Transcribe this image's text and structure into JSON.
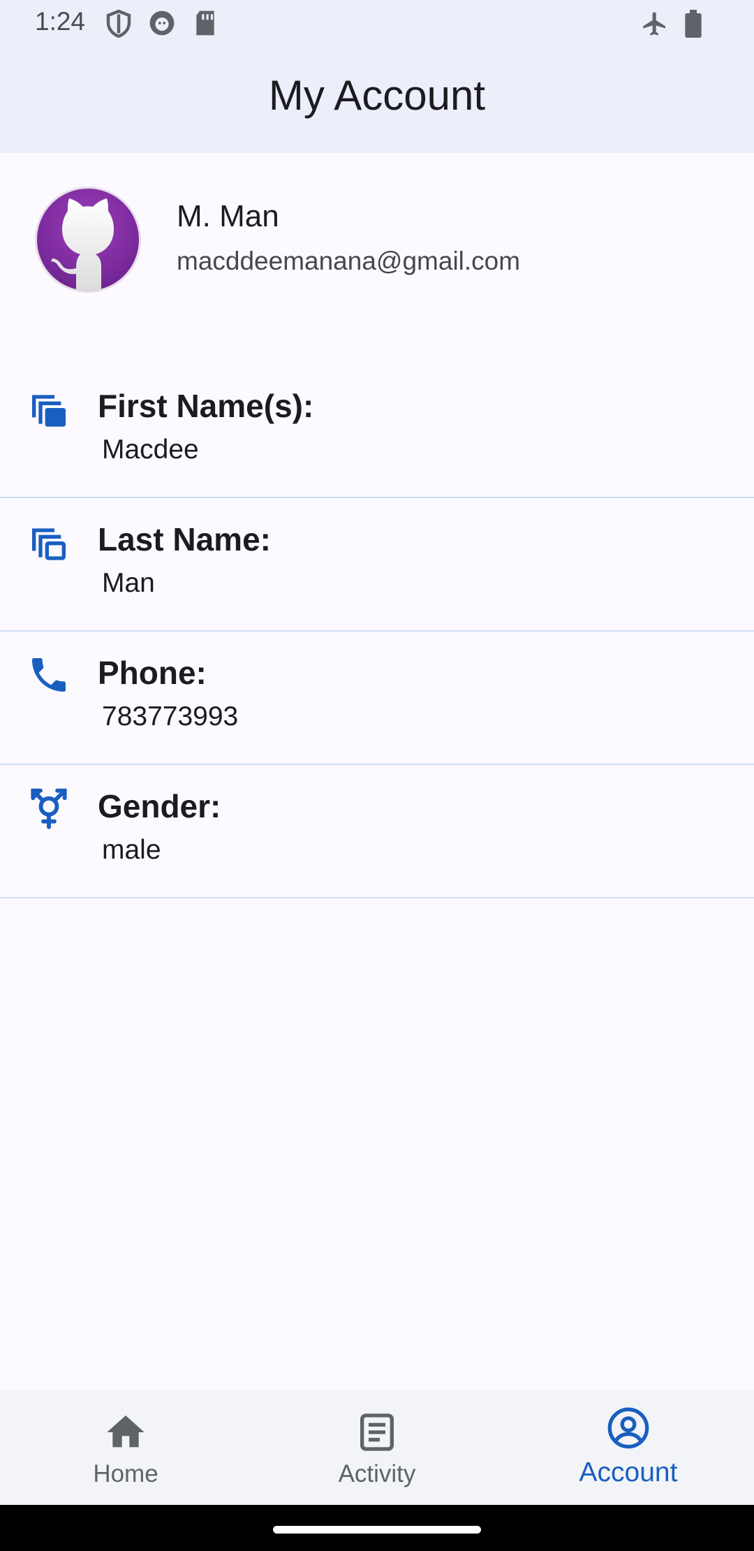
{
  "status_bar": {
    "time": "1:24",
    "icons": [
      "shield-icon",
      "cat-face-icon",
      "sd-card-icon",
      "airplane-icon",
      "battery-icon"
    ]
  },
  "app_bar": {
    "title": "My Account"
  },
  "profile": {
    "avatar_icon": "github-octocat-icon",
    "name": "M. Man",
    "email": "macddeemanana@gmail.com"
  },
  "details": [
    {
      "icon": "copy-filled-icon",
      "label": "First Name(s):",
      "value": "Macdee"
    },
    {
      "icon": "copy-outline-icon",
      "label": "Last Name:",
      "value": "Man"
    },
    {
      "icon": "phone-icon",
      "label": "Phone:",
      "value": "783773993"
    },
    {
      "icon": "gender-icon",
      "label": "Gender:",
      "value": "male"
    }
  ],
  "bottom_nav": {
    "items": [
      {
        "icon": "home-icon",
        "label": "Home",
        "active": false
      },
      {
        "icon": "activity-icon",
        "label": "Activity",
        "active": false
      },
      {
        "icon": "account-icon",
        "label": "Account",
        "active": true
      }
    ]
  },
  "colors": {
    "accent": "#1a5fc0",
    "app_bar_bg": "#eceff9",
    "divider": "#cfe0f2",
    "avatar_purple": "#7b2a9d"
  }
}
